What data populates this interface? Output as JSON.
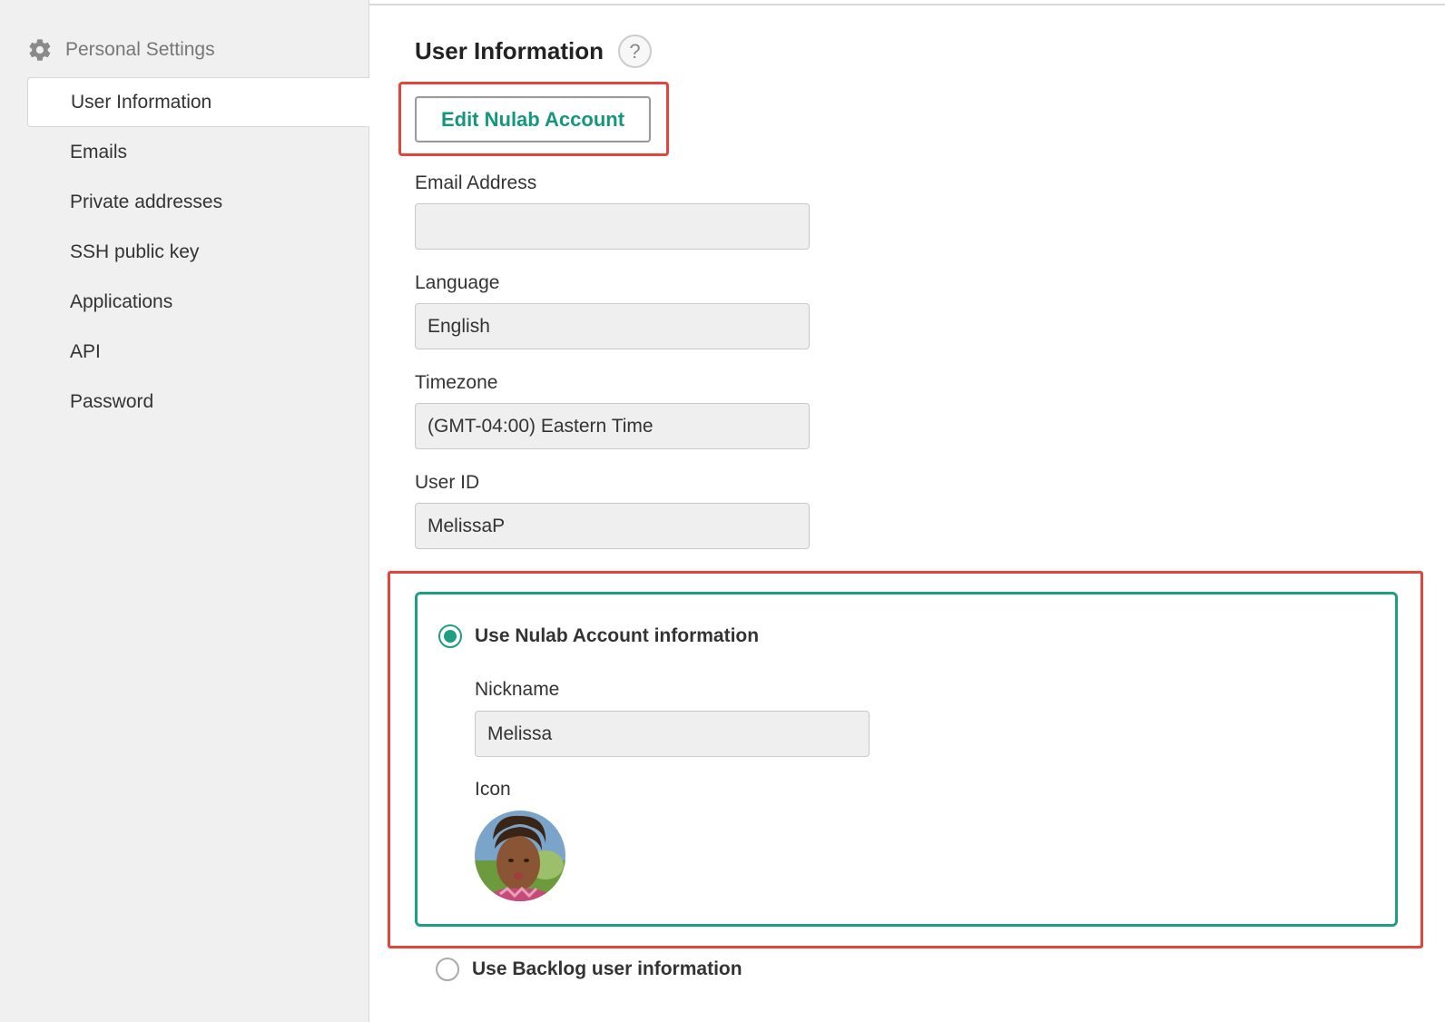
{
  "sidebar": {
    "header_icon": "gear-icon",
    "header_label": "Personal Settings",
    "items": [
      {
        "label": "User Information",
        "active": true
      },
      {
        "label": "Emails",
        "active": false
      },
      {
        "label": "Private addresses",
        "active": false
      },
      {
        "label": "SSH public key",
        "active": false
      },
      {
        "label": "Applications",
        "active": false
      },
      {
        "label": "API",
        "active": false
      },
      {
        "label": "Password",
        "active": false
      }
    ]
  },
  "main": {
    "title": "User Information",
    "help_label": "?",
    "edit_button_label": "Edit Nulab Account",
    "email": {
      "label": "Email Address",
      "value": ""
    },
    "language": {
      "label": "Language",
      "value": "English"
    },
    "timezone": {
      "label": "Timezone",
      "value": "(GMT-04:00) Eastern Time"
    },
    "user_id": {
      "label": "User ID",
      "value": "MelissaP"
    },
    "nulab_option": {
      "label": "Use Nulab Account information",
      "selected": true,
      "nickname_label": "Nickname",
      "nickname_value": "Melissa",
      "icon_label": "Icon"
    },
    "backlog_option": {
      "label": "Use Backlog user information",
      "selected": false
    }
  },
  "colors": {
    "accent_green": "#1f9e86",
    "button_text_green": "#14977e",
    "highlight_red": "#e5443a",
    "sidebar_bg": "#f0f0f0"
  }
}
